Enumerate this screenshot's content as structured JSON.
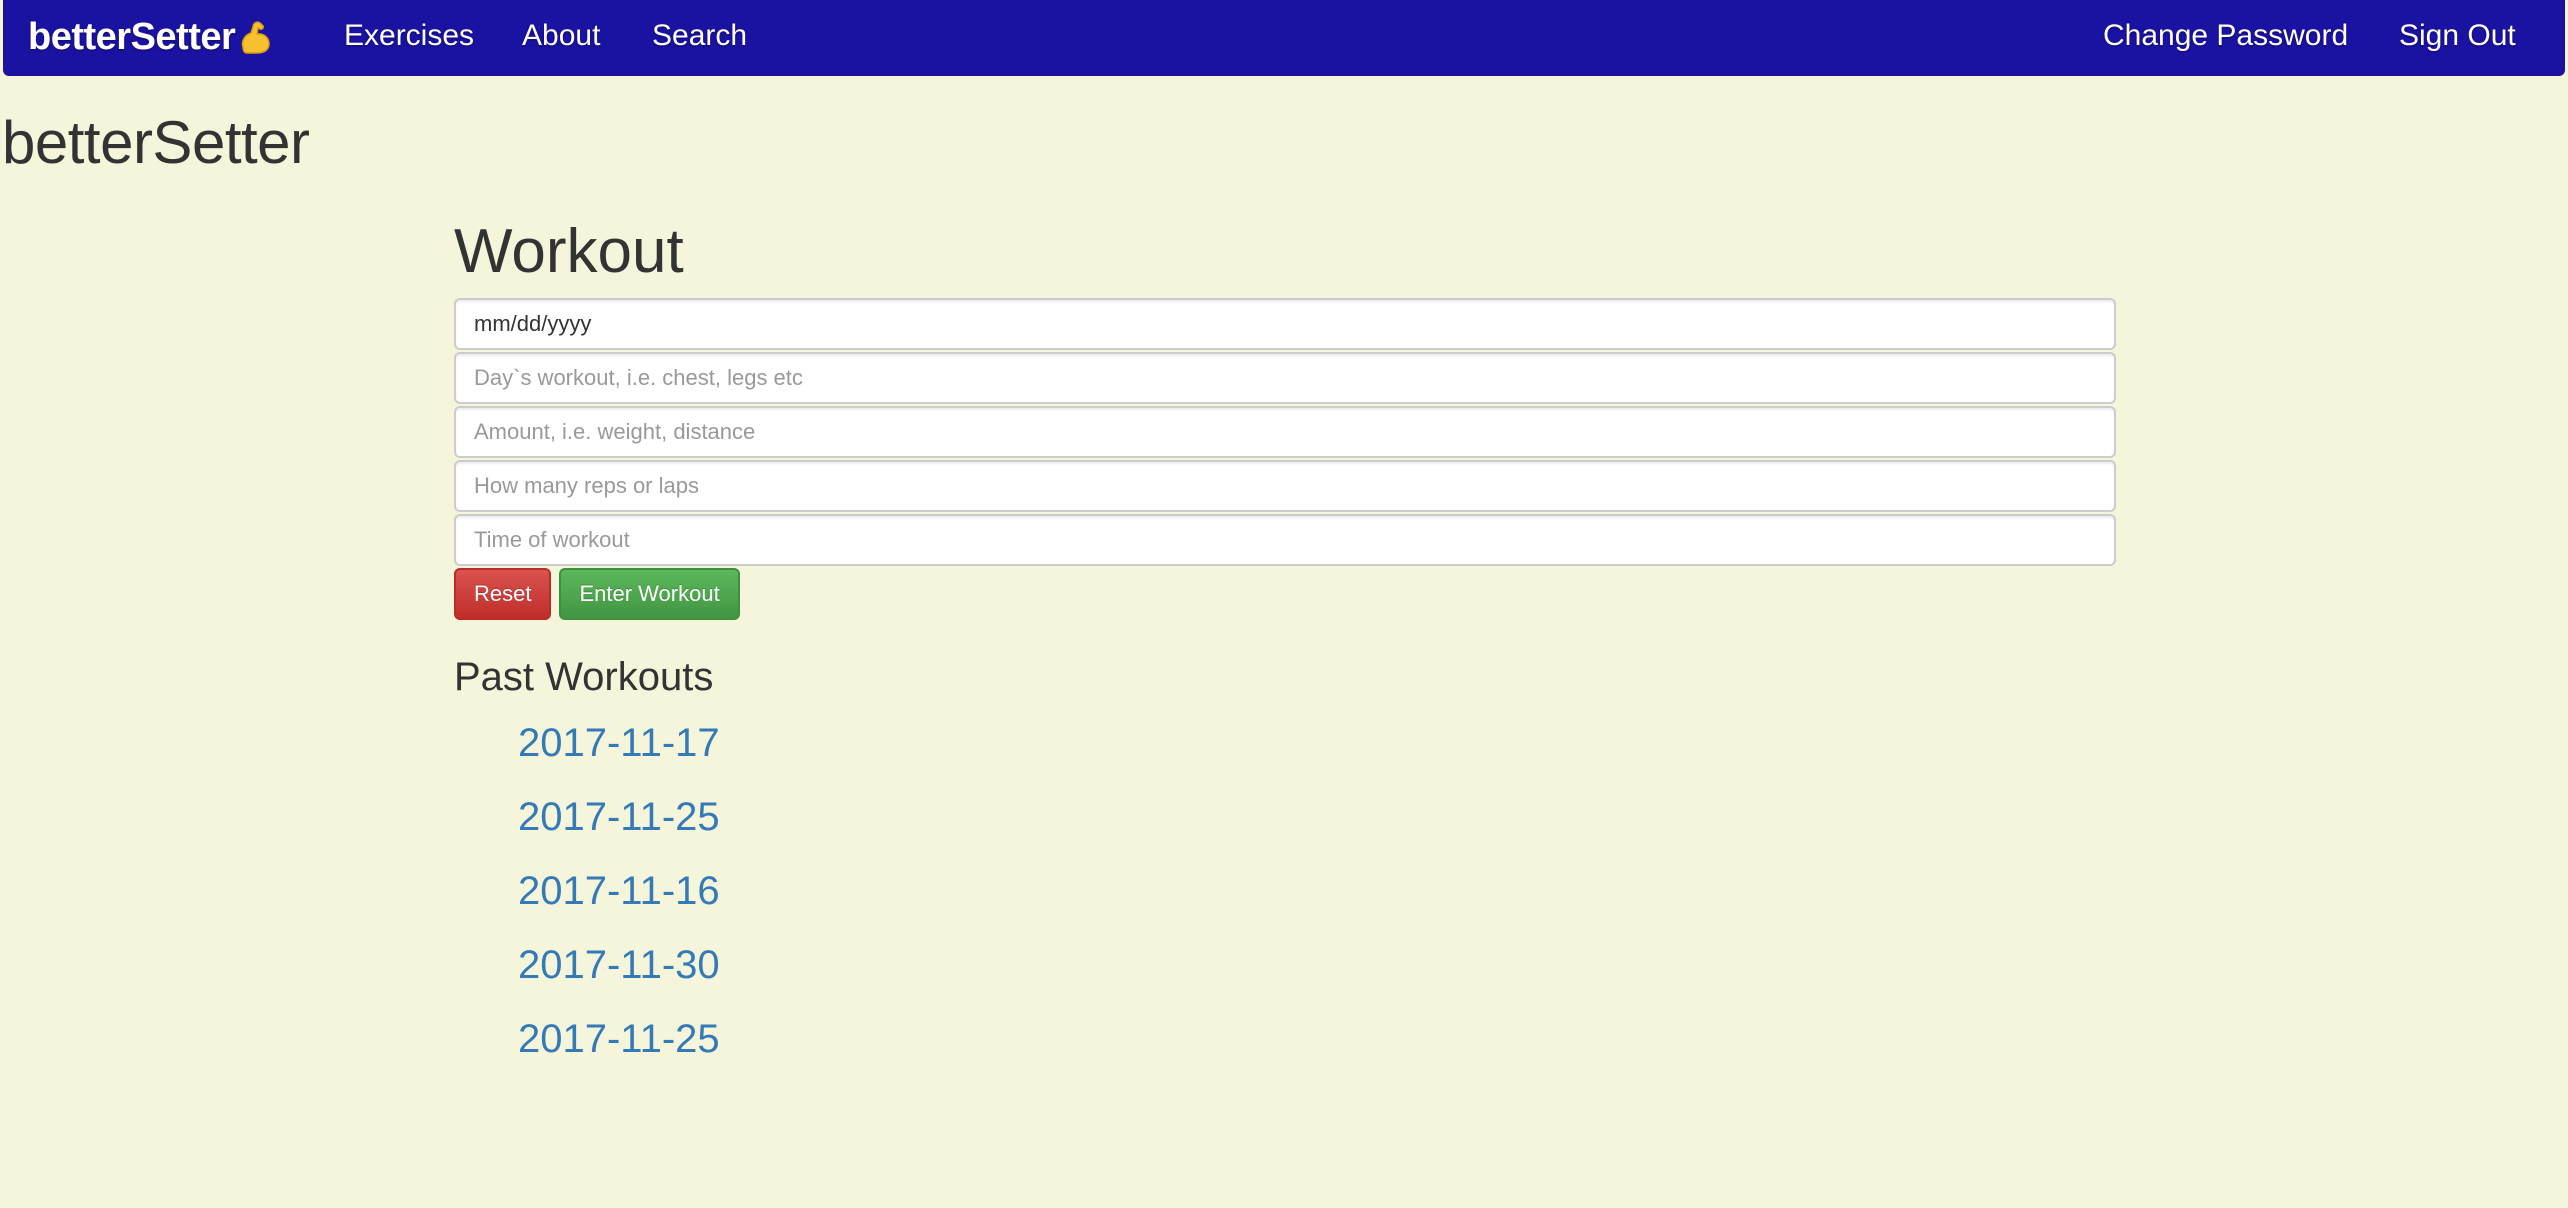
{
  "navbar": {
    "brand": "betterSetter",
    "brand_icon": "flexed-biceps-icon",
    "links": [
      {
        "label": "Exercises"
      },
      {
        "label": "About"
      },
      {
        "label": "Search"
      }
    ],
    "right_links": [
      {
        "label": "Change Password"
      },
      {
        "label": "Sign Out"
      }
    ],
    "background": "#1a12a1"
  },
  "page": {
    "brand_heading": "betterSetter",
    "background": "#f5f5dc"
  },
  "workout": {
    "title": "Workout",
    "date_value": "mm/dd/yyyy",
    "workout_placeholder": "Day`s workout, i.e. chest, legs etc",
    "amount_placeholder": "Amount, i.e. weight, distance",
    "reps_placeholder": "How many reps or laps",
    "time_placeholder": "Time of workout",
    "reset_label": "Reset",
    "enter_label": "Enter Workout"
  },
  "past_workouts": {
    "title": "Past Workouts",
    "items": [
      "2017-11-17",
      "2017-11-25",
      "2017-11-16",
      "2017-11-30",
      "2017-11-25"
    ]
  }
}
